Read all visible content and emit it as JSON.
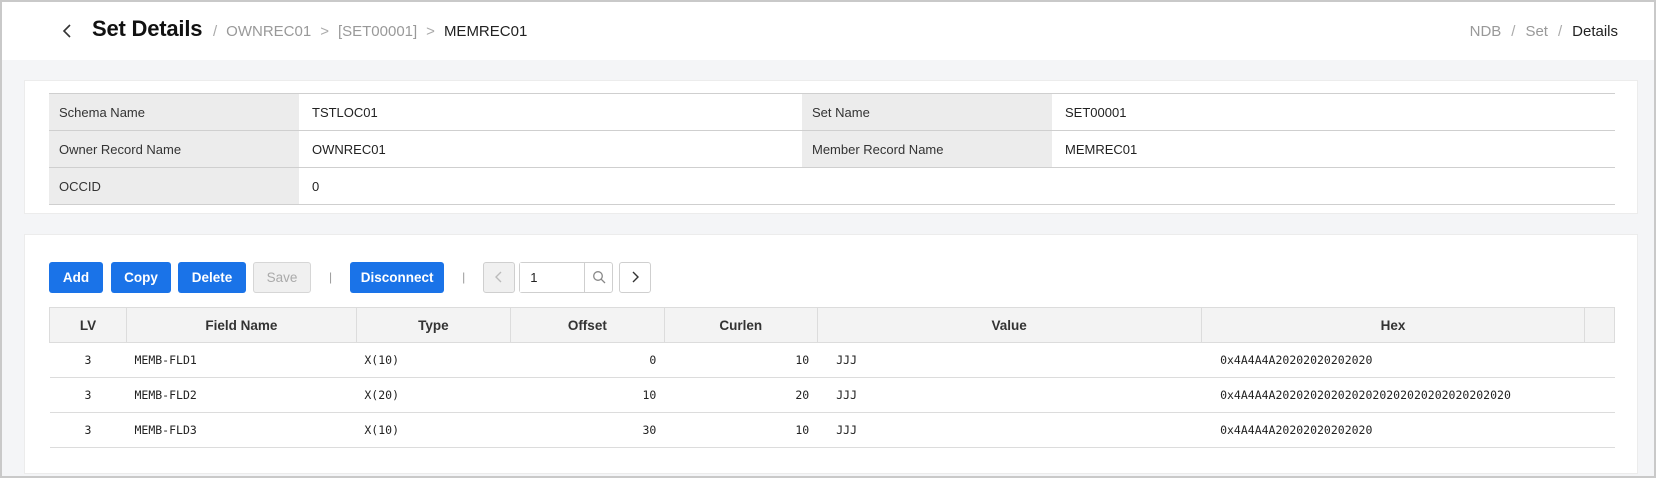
{
  "header": {
    "title": "Set Details",
    "path": [
      "OWNREC01",
      "[SET00001]",
      "MEMREC01"
    ],
    "path_separators": [
      "/",
      ">",
      ">"
    ],
    "breadcrumb": [
      "NDB",
      "Set",
      "Details"
    ],
    "breadcrumb_sep": "/"
  },
  "info": {
    "schema_name_label": "Schema Name",
    "schema_name_value": "TSTLOC01",
    "set_name_label": "Set Name",
    "set_name_value": "SET00001",
    "owner_record_label": "Owner Record Name",
    "owner_record_value": "OWNREC01",
    "member_record_label": "Member Record Name",
    "member_record_value": "MEMREC01",
    "occid_label": "OCCID",
    "occid_value": "0"
  },
  "toolbar": {
    "add": "Add",
    "copy": "Copy",
    "delete": "Delete",
    "save": "Save",
    "disconnect": "Disconnect",
    "divider": "|",
    "page_value": "1"
  },
  "grid": {
    "columns": [
      "LV",
      "Field Name",
      "Type",
      "Offset",
      "Curlen",
      "Value",
      "Hex"
    ],
    "rows": [
      {
        "lv": "3",
        "field": "MEMB-FLD1",
        "type": "X(10)",
        "offset": "0",
        "curlen": "10",
        "value": "JJJ",
        "hex": "0x4A4A4A20202020202020"
      },
      {
        "lv": "3",
        "field": "MEMB-FLD2",
        "type": "X(20)",
        "offset": "10",
        "curlen": "20",
        "value": "JJJ",
        "hex": "0x4A4A4A2020202020202020202020202020202020"
      },
      {
        "lv": "3",
        "field": "MEMB-FLD3",
        "type": "X(10)",
        "offset": "30",
        "curlen": "10",
        "value": "JJJ",
        "hex": "0x4A4A4A20202020202020"
      }
    ]
  },
  "colors": {
    "primary": "#1a73e8",
    "label_bg": "#ececec",
    "page_bg": "#f4f5f7"
  }
}
